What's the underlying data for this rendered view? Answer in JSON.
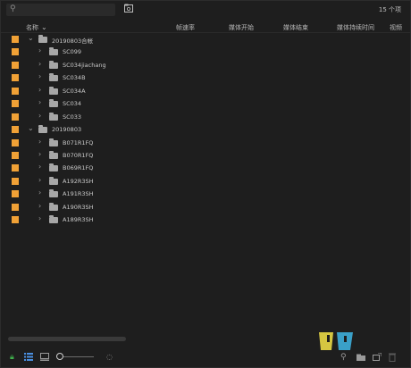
{
  "search": {
    "placeholder": ""
  },
  "item_count": "15 个项",
  "columns": {
    "name": "名称",
    "fps": "帧速率",
    "media_start": "媒体开始",
    "media_end": "媒体结束",
    "media_duration": "媒体持续时间",
    "video": "视频"
  },
  "rows": [
    {
      "label": "20190803合帐",
      "level": 0,
      "expanded": true
    },
    {
      "label": "SC099",
      "level": 1,
      "expanded": false
    },
    {
      "label": "SC034jiachang",
      "level": 1,
      "expanded": false
    },
    {
      "label": "SC034B",
      "level": 1,
      "expanded": false
    },
    {
      "label": "SC034A",
      "level": 1,
      "expanded": false
    },
    {
      "label": "SC034",
      "level": 1,
      "expanded": false
    },
    {
      "label": "SC033",
      "level": 1,
      "expanded": false
    },
    {
      "label": "20190803",
      "level": 0,
      "expanded": true
    },
    {
      "label": "B071R1FQ",
      "level": 1,
      "expanded": false
    },
    {
      "label": "B070R1FQ",
      "level": 1,
      "expanded": false
    },
    {
      "label": "B069R1FQ",
      "level": 1,
      "expanded": false
    },
    {
      "label": "A192R3SH",
      "level": 1,
      "expanded": false
    },
    {
      "label": "A191R3SH",
      "level": 1,
      "expanded": false
    },
    {
      "label": "A190R3SH",
      "level": 1,
      "expanded": false
    },
    {
      "label": "A189R3SH",
      "level": 1,
      "expanded": false
    }
  ],
  "colors": {
    "label_swatch": "#f0a136",
    "folder": "#a7a7a7",
    "lock": "#3fb04c"
  }
}
